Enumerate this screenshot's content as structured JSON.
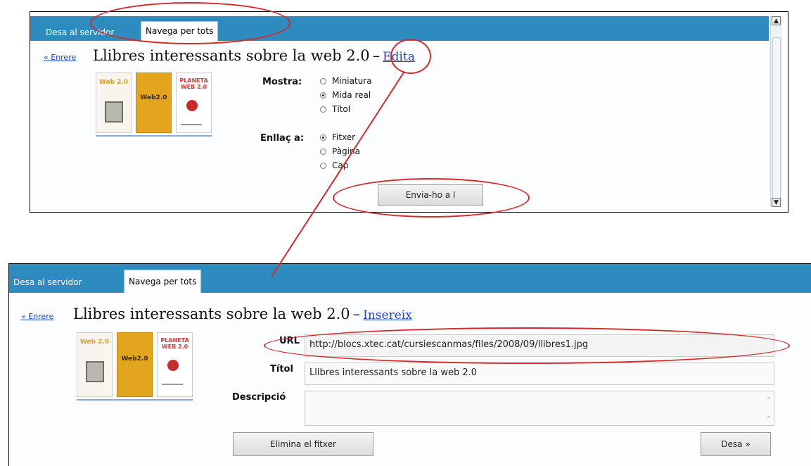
{
  "top_panel": {
    "tabs": [
      {
        "label": "Desa al servidor",
        "active": false
      },
      {
        "label": "Navega per tots",
        "active": true
      }
    ],
    "back_link": "« Enrere",
    "heading": "Llibres interessants sobre la web 2.0",
    "dash": "–",
    "action_link": "Edita",
    "thumbnails": [
      {
        "label": "Web 2.0"
      },
      {
        "label": "Web2.0"
      },
      {
        "label": "PLANETA WEB 2.0"
      }
    ],
    "show": {
      "label": "Mostra:",
      "options": [
        {
          "label": "Miniatura",
          "checked": false
        },
        {
          "label": "Mida real",
          "checked": true
        },
        {
          "label": "Títol",
          "checked": false
        }
      ]
    },
    "link": {
      "label": "Enllaç a:",
      "options": [
        {
          "label": "Fitxer",
          "checked": true
        },
        {
          "label": "Pàgina",
          "checked": false
        },
        {
          "label": "Cap",
          "checked": false
        }
      ]
    },
    "send_button": "Envia-ho a l"
  },
  "bottom_panel": {
    "tabs": [
      {
        "label": "Desa al servidor",
        "active": false
      },
      {
        "label": "Navega per tots",
        "active": true
      }
    ],
    "back_link": "« Enrere",
    "heading": "Llibres interessants sobre la web 2.0",
    "dash": "–",
    "action_link": "Insereix",
    "thumbnails": [
      {
        "label": "Web 2.0"
      },
      {
        "label": "Web2.0"
      },
      {
        "label": "PLANETA WEB 2.0"
      }
    ],
    "fields": {
      "url_label": "URL",
      "url_value": "http://blocs.xtec.cat/cursiescanmas/files/2008/09/llibres1.jpg",
      "title_label": "Títol",
      "title_value": "Llibres interessants sobre la web 2.0",
      "description_label": "Descripció",
      "description_value": ""
    },
    "delete_button": "Elimina el fitxer",
    "save_button": "Desa »"
  },
  "colors": {
    "tab_bar": "#2e8bbf",
    "annotation": "#d42a2a",
    "link": "#2a3fc9"
  }
}
